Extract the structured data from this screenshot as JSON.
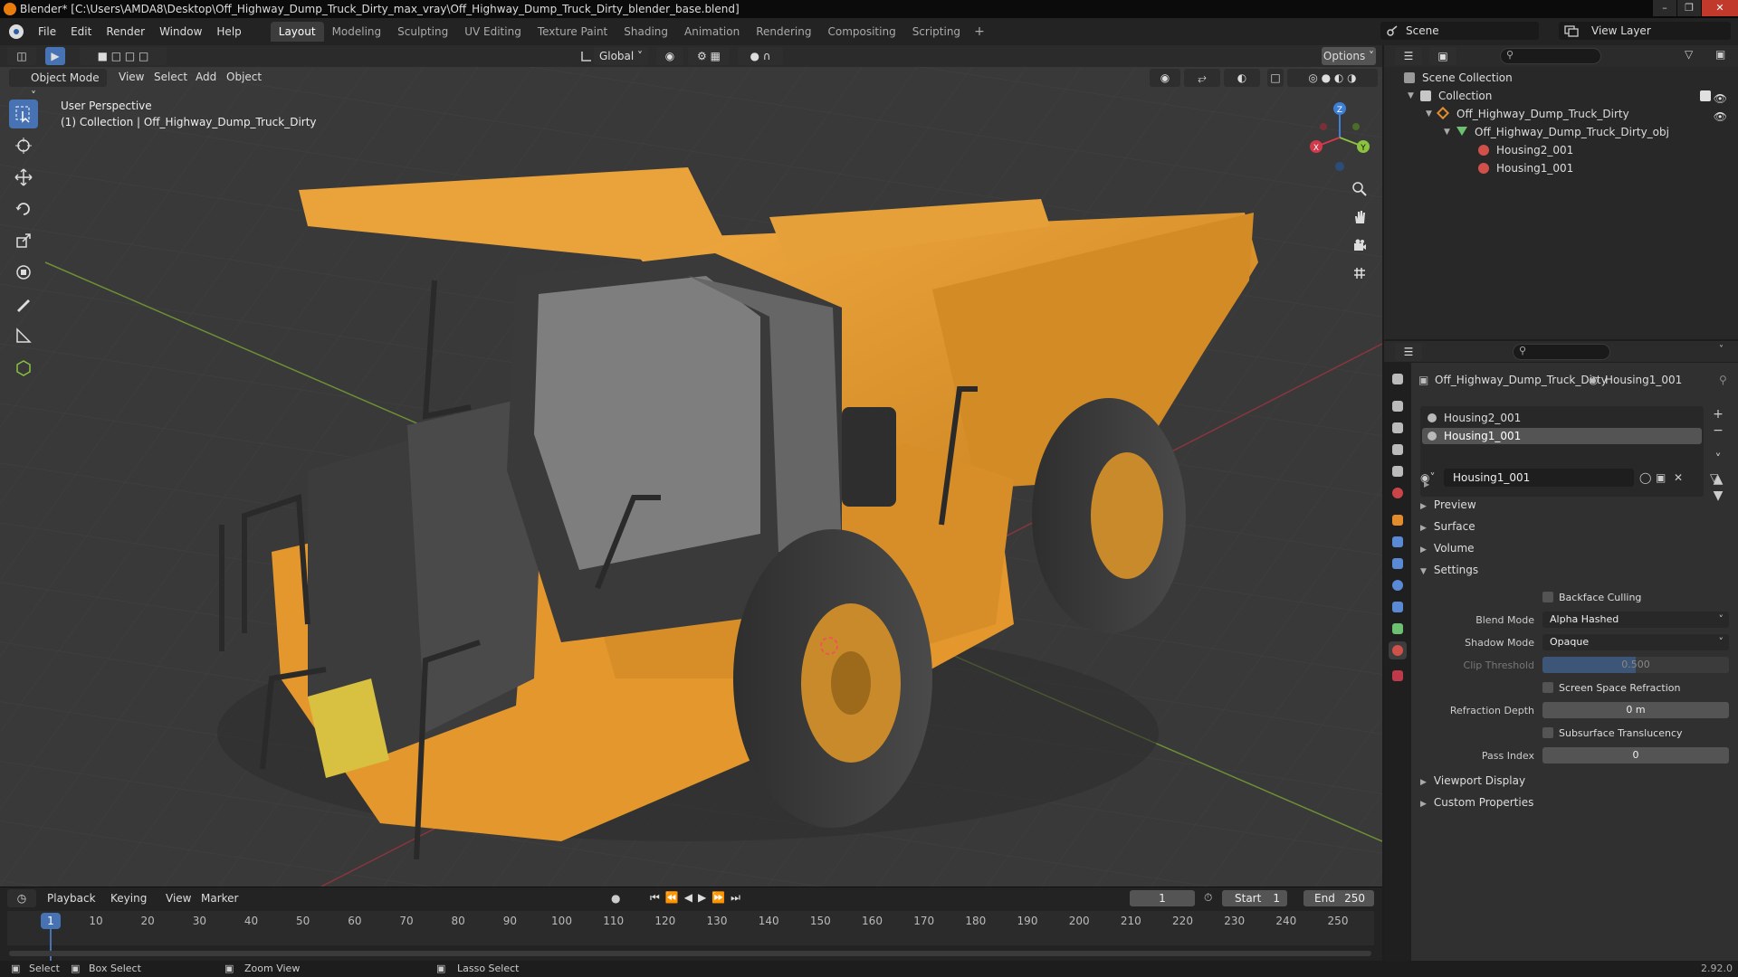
{
  "window": {
    "title": "Blender* [C:\\Users\\AMDA8\\Desktop\\Off_Highway_Dump_Truck_Dirty_max_vray\\Off_Highway_Dump_Truck_Dirty_blender_base.blend]"
  },
  "menu": [
    "File",
    "Edit",
    "Render",
    "Window",
    "Help"
  ],
  "workspaces": [
    "Layout",
    "Modeling",
    "Sculpting",
    "UV Editing",
    "Texture Paint",
    "Shading",
    "Animation",
    "Rendering",
    "Compositing",
    "Scripting"
  ],
  "active_workspace": "Layout",
  "scene": "Scene",
  "view_layer": "View Layer",
  "viewport": {
    "mode": "Object Mode",
    "menus": [
      "View",
      "Select",
      "Add",
      "Object"
    ],
    "orientation": "Global",
    "options_label": "Options",
    "info_line1": "User Perspective",
    "info_line2": "(1) Collection | Off_Highway_Dump_Truck_Dirty",
    "gizmo_axes": [
      "X",
      "Y",
      "Z"
    ]
  },
  "timeline": {
    "menus": [
      "Playback",
      "Keying",
      "View",
      "Marker"
    ],
    "current_frame": "1",
    "start_label": "Start",
    "start": "1",
    "end_label": "End",
    "end": "250",
    "ticks": [
      "10",
      "20",
      "30",
      "40",
      "50",
      "60",
      "70",
      "80",
      "90",
      "100",
      "110",
      "120",
      "130",
      "140",
      "150",
      "160",
      "170",
      "180",
      "190",
      "200",
      "210",
      "220",
      "230",
      "240",
      "250"
    ],
    "playhead": "1"
  },
  "statusbar": {
    "select": "Select",
    "box_select": "Box Select",
    "zoom_view": "Zoom View",
    "lasso_select": "Lasso Select",
    "version": "2.92.0"
  },
  "outliner": {
    "scene_collection": "Scene Collection",
    "collection": "Collection",
    "object": "Off_Highway_Dump_Truck_Dirty",
    "mesh": "Off_Highway_Dump_Truck_Dirty_obj",
    "materials": [
      "Housing2_001",
      "Housing1_001"
    ]
  },
  "properties": {
    "breadcrumb_object": "Off_Highway_Dump_Truck_Dirty",
    "breadcrumb_material": "Housing1_001",
    "slots": [
      "Housing2_001",
      "Housing1_001"
    ],
    "selected_slot": "Housing1_001",
    "material_name": "Housing1_001",
    "sections_top": [
      "Preview",
      "Surface",
      "Volume",
      "Settings"
    ],
    "settings": {
      "backface_culling": "Backface Culling",
      "blend_mode_label": "Blend Mode",
      "blend_mode": "Alpha Hashed",
      "shadow_mode_label": "Shadow Mode",
      "shadow_mode": "Opaque",
      "clip_threshold_label": "Clip Threshold",
      "clip_threshold": "0.500",
      "ssr_label": "Screen Space Refraction",
      "refraction_depth_label": "Refraction Depth",
      "refraction_depth": "0 m",
      "subsurface_label": "Subsurface Translucency",
      "pass_index_label": "Pass Index",
      "pass_index": "0"
    },
    "sections_bottom": [
      "Viewport Display",
      "Custom Properties"
    ]
  },
  "colors": {
    "accent": "#4772b3",
    "truck_body": "#e0962e",
    "viewport_bg": "#393939",
    "axis_x": "#d23a4b",
    "axis_y": "#8bc23f",
    "axis_z": "#3d7fd8"
  }
}
